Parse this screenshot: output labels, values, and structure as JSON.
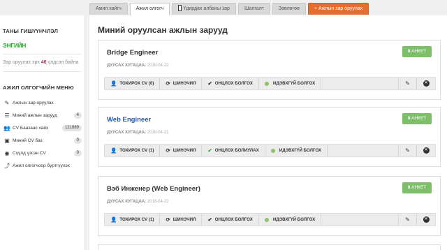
{
  "tabs": [
    {
      "label": "Ажил хайгч"
    },
    {
      "label": "Ажил олгогч"
    },
    {
      "label": "Үдирдах албаны зар"
    },
    {
      "label": "Шалгалт"
    },
    {
      "label": "Зөвлөгөө"
    },
    {
      "label": "Ажлын зар оруулах"
    }
  ],
  "sidebar": {
    "account_heading": "ТАНЫ ГИШҮҮНЧЛЭЛ",
    "membership": "ЭНГИЙН",
    "quota_prefix": "Зар оруулах эрх",
    "quota_value": "46",
    "quota_suffix": "үлдсэн байна",
    "menu_heading": "АЖИЛ ОЛГОГЧИЙН МЕНЮ",
    "items": [
      {
        "label": "Ажлын зар оруулах",
        "icon": "pencil-icon",
        "badge": ""
      },
      {
        "label": "Миний ажлын зарууд",
        "icon": "list-icon",
        "badge": "4"
      },
      {
        "label": "CV Баазаас хайх",
        "icon": "users-icon",
        "badge": "121889"
      },
      {
        "label": "Миний CV баз",
        "icon": "save-icon",
        "badge": "0"
      },
      {
        "label": "Сүүлд үзсэн CV",
        "icon": "eye-icon",
        "badge": "0"
      },
      {
        "label": "Ажил олгогчоор бүртгүүлэх",
        "icon": "share-icon",
        "badge": ""
      }
    ]
  },
  "main": {
    "title": "Миний оруулсан ажлын зарууд",
    "deadline_label": "ДУУСАХ ХУГАЦАА:",
    "anket_label": "АНКЕТ",
    "jobs": [
      {
        "title": "Bridge Engineer",
        "deadline": "2018-04-22",
        "anket": "0",
        "matching_cv": "ТОХИРОХ CV (0)",
        "review": "ШИНЭЧИЛ",
        "featured": "ОНЦЛОХ БОЛГОХ",
        "active": "ИДЭВХГҮЙ БОЛГОХ"
      },
      {
        "title": "Web Engineer",
        "deadline": "2018-04-21",
        "anket": "0",
        "matching_cv": "ТОХИРОХ CV (1)",
        "review": "ШИНЭЧИЛ",
        "featured": "ОНЦЛОХ БОЛИУЛАХ",
        "active": "ИДЭВХГҮЙ БОЛГОХ"
      },
      {
        "title": "Вэб Инженер (Web Engineer)",
        "deadline": "2018-04-22",
        "anket": "0",
        "matching_cv": "ТОХИРОХ CV (1)",
        "review": "ШИНЭЧИЛ",
        "featured": "ОНЦЛОХ БОЛГОХ",
        "active": "ИДЭВХГҮЙ БОЛГОХ"
      }
    ]
  },
  "colors": {
    "accent_orange": "#e86c2a",
    "status_green": "#2a9d2a",
    "anket_green": "#7ec06a",
    "link_blue": "#2a57a8",
    "quota_red": "#d9222a"
  }
}
